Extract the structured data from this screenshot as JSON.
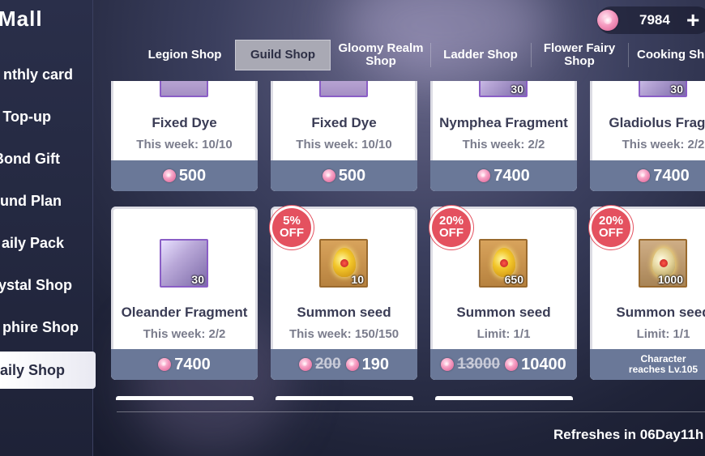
{
  "sidebar": {
    "title": "Mall",
    "items": [
      {
        "label": "nthly card"
      },
      {
        "label": "Top-up"
      },
      {
        "label": "Bond Gift"
      },
      {
        "label": "und Plan"
      },
      {
        "label": "aily Pack"
      },
      {
        "label": "ystal Shop"
      },
      {
        "label": "phire Shop"
      },
      {
        "label": "aily Shop"
      }
    ]
  },
  "currency": {
    "amount": "7984",
    "plus": "+",
    "icon": "gem-icon"
  },
  "tabs": [
    {
      "label": "Legion Shop"
    },
    {
      "label": "Guild Shop"
    },
    {
      "label": "Gloomy Realm Shop"
    },
    {
      "label": "Ladder Shop"
    },
    {
      "label": "Flower Fairy Shop"
    },
    {
      "label": "Cooking Sh"
    }
  ],
  "row1": [
    {
      "name": "Fixed Dye",
      "limit": "This week: 10/10",
      "price": "500"
    },
    {
      "name": "Fixed Dye",
      "limit": "This week: 10/10",
      "price": "500"
    },
    {
      "name": "Nymphea Fragment",
      "limit": "This week: 2/2",
      "price": "7400",
      "count": "30"
    },
    {
      "name": "Gladiolus Fragm",
      "limit": "This week: 2/2",
      "price": "7400",
      "count": "30"
    }
  ],
  "row2": [
    {
      "name": "Oleander Fragment",
      "limit": "This week: 2/2",
      "price": "7400",
      "count": "30"
    },
    {
      "name": "Summon seed",
      "limit": "This week: 150/150",
      "old_price": "200",
      "price": "190",
      "count": "10",
      "discount": "5% OFF"
    },
    {
      "name": "Summon seed",
      "limit": "Limit: 1/1",
      "old_price": "13000",
      "price": "10400",
      "count": "650",
      "discount": "20% OFF"
    },
    {
      "name": "Summon seed",
      "limit": "Limit: 1/1",
      "requirement": "Character reaches Lv.105",
      "count": "1000",
      "discount": "20% OFF"
    }
  ],
  "refresh": "Refreshes in 06Day11h"
}
